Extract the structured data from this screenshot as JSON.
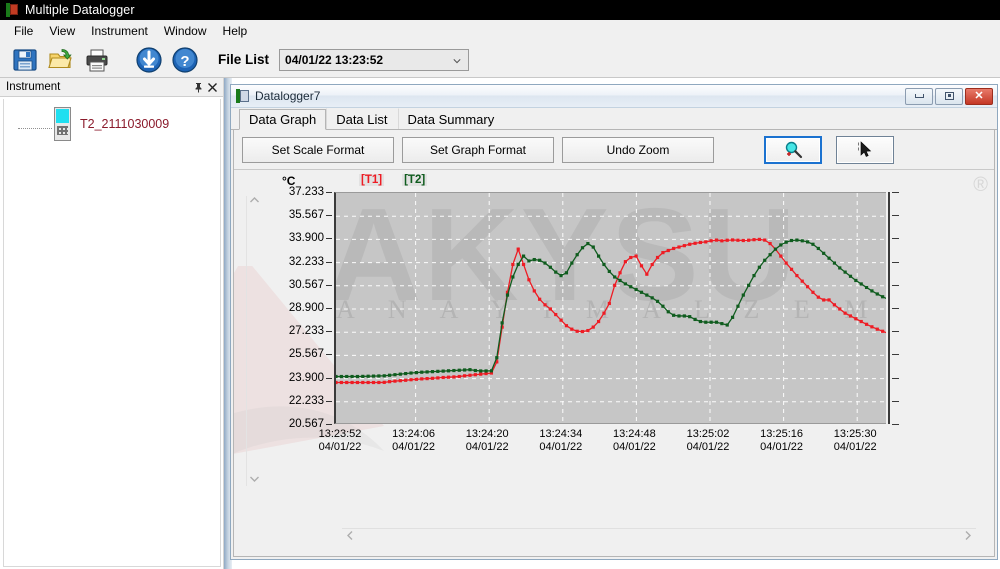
{
  "window": {
    "title": "Multiple Datalogger",
    "icon": "datalogger-app-icon"
  },
  "menubar": {
    "items": [
      {
        "label": "File",
        "accel": "F"
      },
      {
        "label": "View",
        "accel": "V"
      },
      {
        "label": "Instrument",
        "accel": "I"
      },
      {
        "label": "Window",
        "accel": "W"
      },
      {
        "label": "Help",
        "accel": "H"
      }
    ]
  },
  "toolbar": {
    "buttons": [
      {
        "name": "save-icon",
        "title": "Save"
      },
      {
        "name": "open-folder-icon",
        "title": "Open"
      },
      {
        "name": "print-icon",
        "title": "Print"
      },
      {
        "name": "download-icon",
        "title": "Download"
      },
      {
        "name": "help-icon",
        "title": "Help"
      }
    ],
    "file_list_label": "File List",
    "file_list_value": "04/01/22 13:23:52",
    "file_list_options": [
      "04/01/22 13:23:52"
    ]
  },
  "dock": {
    "title": "Instrument",
    "pin_icon": "pin-icon",
    "close_icon": "close-icon",
    "tree": [
      {
        "label": "T2_2111030009",
        "icon": "device-icon",
        "color": "#8b1a2b"
      }
    ]
  },
  "child_window": {
    "title": "Datalogger7",
    "minimize_label": "Minimize",
    "maximize_label": "Restore",
    "close_label": "Close",
    "tabs": [
      {
        "label": "Data Graph",
        "active": true
      },
      {
        "label": "Data List",
        "active": false
      },
      {
        "label": "Data Summary",
        "active": false
      }
    ],
    "buttons": [
      {
        "label": "Set Scale Format",
        "name": "set-scale-format-button"
      },
      {
        "label": "Set Graph Format",
        "name": "set-graph-format-button"
      },
      {
        "label": "Undo Zoom",
        "name": "undo-zoom-button"
      }
    ],
    "tool_buttons": [
      {
        "name": "zoom-tool-button",
        "icon": "magnifier-icon",
        "selected": true
      },
      {
        "name": "pointer-tool-button",
        "icon": "cursor-icon",
        "selected": false
      }
    ]
  },
  "graph": {
    "unit_label": "°C",
    "registered_mark": "®",
    "watermark_text": "A N A Y I   M A L Z E M E L E R İ",
    "watermark_big": "AKYSU",
    "scroll": {
      "up_icon": "chevron-up-icon",
      "down_icon": "chevron-down-icon",
      "left_icon": "chevron-left-icon",
      "right_icon": "chevron-right-icon"
    }
  },
  "chart_data": {
    "type": "line",
    "title": "",
    "xlabel": "",
    "ylabel": "°C",
    "grid": true,
    "legend_position": "top-left",
    "plot_background": "#c6c6c6",
    "ylim": [
      20.567,
      37.233
    ],
    "yticks": [
      37.233,
      35.567,
      33.9,
      32.233,
      30.567,
      28.9,
      27.233,
      25.567,
      23.9,
      22.233,
      20.567
    ],
    "ytick_labels": [
      "37.233",
      "35.567",
      "33.900",
      "32.233",
      "30.567",
      "28.900",
      "27.233",
      "25.567",
      "23.900",
      "22.233",
      "20.567"
    ],
    "xtick_labels": [
      {
        "time": "13:23:52",
        "date": "04/01/22"
      },
      {
        "time": "13:24:06",
        "date": "04/01/22"
      },
      {
        "time": "13:24:20",
        "date": "04/01/22"
      },
      {
        "time": "13:24:34",
        "date": "04/01/22"
      },
      {
        "time": "13:24:48",
        "date": "04/01/22"
      },
      {
        "time": "13:25:02",
        "date": "04/01/22"
      },
      {
        "time": "13:25:16",
        "date": "04/01/22"
      },
      {
        "time": "13:25:30",
        "date": "04/01/22"
      }
    ],
    "xlim": [
      "13:23:52",
      "13:25:37"
    ],
    "series": [
      {
        "name": "T1",
        "legend_label": "[T1]",
        "color": "#ee1c24",
        "marker": "square",
        "values": [
          23.62,
          23.62,
          23.62,
          23.62,
          23.62,
          23.62,
          23.62,
          23.62,
          23.62,
          23.63,
          23.68,
          23.72,
          23.75,
          23.78,
          23.82,
          23.85,
          23.88,
          23.9,
          23.92,
          23.95,
          23.98,
          24.0,
          24.02,
          24.05,
          24.1,
          24.14,
          24.18,
          24.22,
          24.26,
          24.3,
          25.1,
          27.6,
          30.1,
          32.1,
          33.2,
          32.1,
          31.0,
          30.2,
          29.6,
          29.2,
          28.9,
          28.5,
          28.1,
          27.7,
          27.45,
          27.3,
          27.28,
          27.35,
          27.6,
          28.0,
          28.6,
          29.3,
          30.6,
          31.5,
          32.3,
          32.6,
          32.7,
          32.0,
          31.4,
          32.1,
          32.6,
          32.95,
          33.1,
          33.25,
          33.35,
          33.45,
          33.55,
          33.62,
          33.68,
          33.72,
          33.8,
          33.85,
          33.8,
          33.84,
          33.86,
          33.84,
          33.82,
          33.84,
          33.88,
          33.9,
          33.85,
          33.6,
          33.2,
          32.7,
          32.2,
          31.75,
          31.3,
          30.9,
          30.5,
          30.1,
          29.75,
          29.55,
          29.55,
          29.2,
          28.9,
          28.6,
          28.4,
          28.2,
          28.0,
          27.8,
          27.62,
          27.45,
          27.3,
          27.15
        ]
      },
      {
        "name": "T2",
        "legend_label": "[T2]",
        "color": "#0f5c1e",
        "marker": "square",
        "values": [
          24.05,
          24.05,
          24.05,
          24.05,
          24.05,
          24.06,
          24.07,
          24.08,
          24.09,
          24.1,
          24.14,
          24.18,
          24.22,
          24.26,
          24.3,
          24.33,
          24.36,
          24.38,
          24.4,
          24.42,
          24.44,
          24.46,
          24.48,
          24.5,
          24.52,
          24.54,
          24.48,
          24.45,
          24.45,
          24.46,
          25.4,
          27.9,
          29.9,
          31.2,
          32.1,
          32.7,
          32.35,
          32.45,
          32.4,
          32.2,
          31.9,
          31.55,
          31.3,
          31.5,
          32.2,
          32.8,
          33.3,
          33.6,
          33.35,
          32.7,
          32.1,
          31.6,
          31.2,
          30.95,
          30.7,
          30.5,
          30.3,
          30.1,
          29.9,
          29.7,
          29.45,
          29.1,
          28.7,
          28.45,
          28.4,
          28.4,
          28.35,
          28.15,
          28.0,
          27.95,
          27.95,
          27.95,
          27.85,
          27.75,
          28.3,
          29.1,
          29.9,
          30.6,
          31.3,
          31.9,
          32.4,
          32.8,
          33.2,
          33.5,
          33.7,
          33.82,
          33.85,
          33.8,
          33.72,
          33.55,
          33.25,
          32.9,
          32.55,
          32.2,
          31.85,
          31.55,
          31.25,
          30.95,
          30.7,
          30.45,
          30.2,
          29.98,
          29.78,
          29.6
        ]
      }
    ]
  }
}
